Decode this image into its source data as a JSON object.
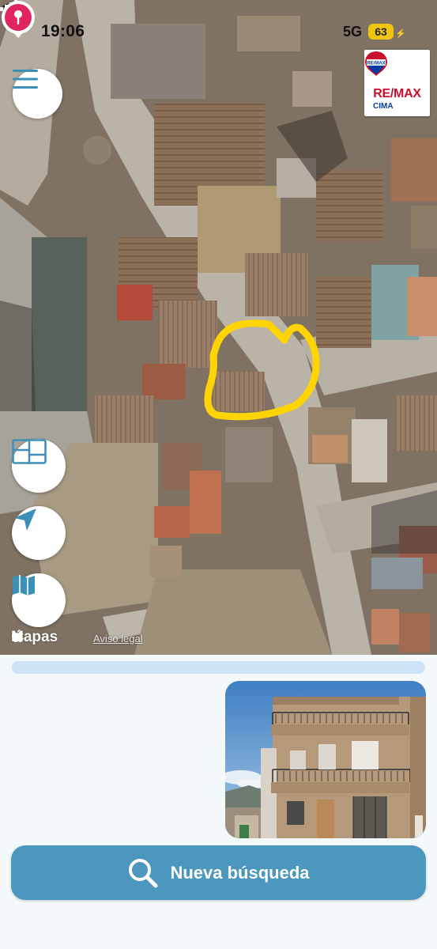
{
  "status_bar": {
    "time": "19:06",
    "network": "5G",
    "battery": "63"
  },
  "logo": {
    "name": "RE/MAX",
    "subtitle": "CIMA",
    "balloon_text": "RE/MAX"
  },
  "map": {
    "attribution": "Mapas",
    "legal_link": "Aviso legal"
  },
  "colors": {
    "accent": "#4b97bd",
    "pin": "#e0245e",
    "highlight": "#ffd400",
    "progress_track": "#cfe3f6"
  },
  "search_button": {
    "label": "Nueva búsqueda"
  }
}
